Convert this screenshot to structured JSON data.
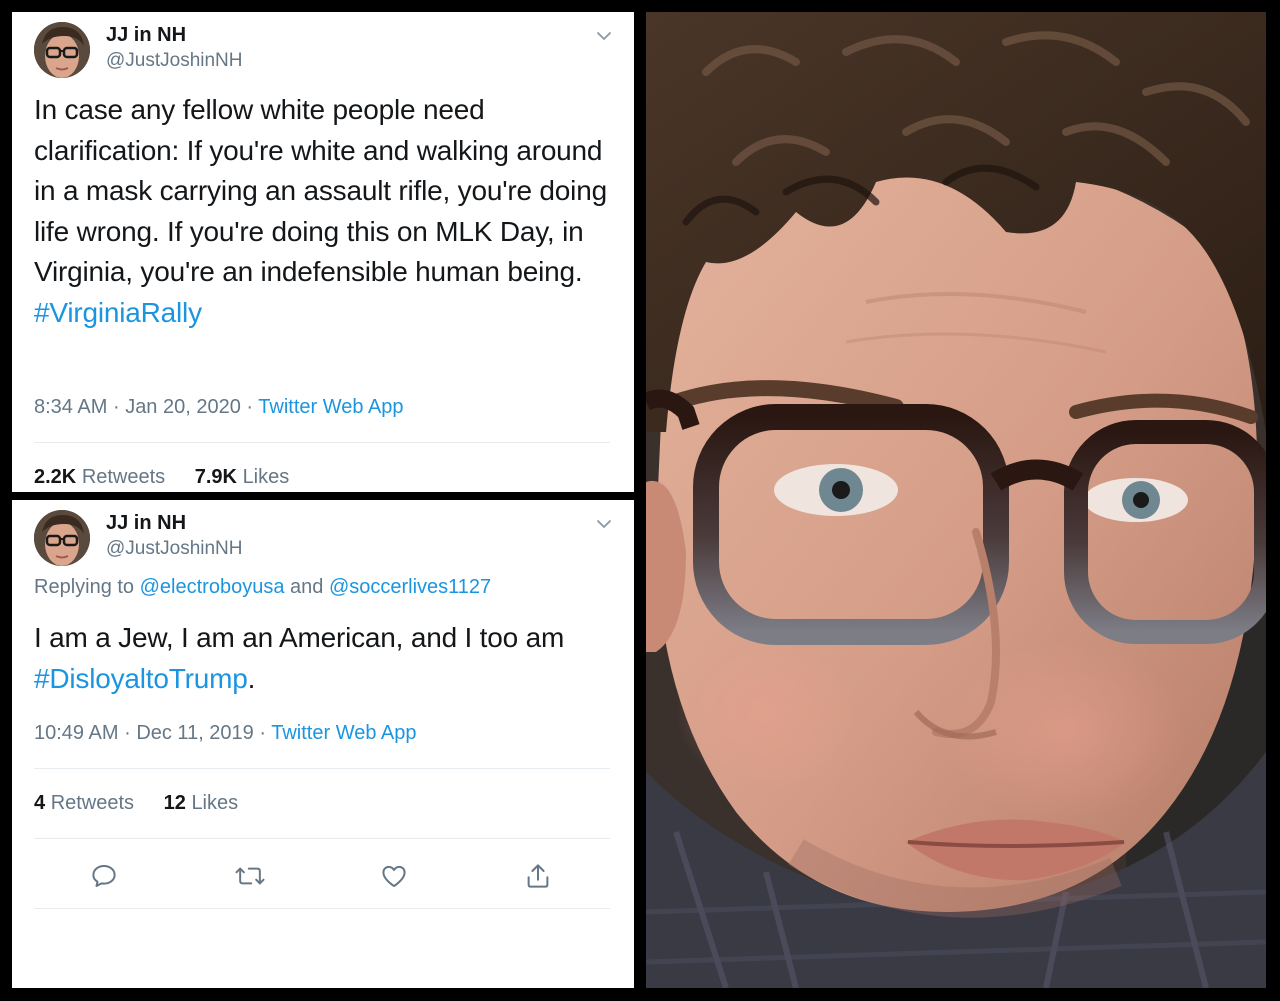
{
  "tweets": [
    {
      "author": {
        "name": "JJ in NH",
        "handle": "@JustJoshinNH"
      },
      "text": "In case any fellow white people need clarification: If you're white and walking around in a mask carrying an assault rifle, you're doing life wrong. If you're doing this on MLK Day, in Virginia, you're an indefensible human being.",
      "hashtag": "#VirginiaRally",
      "time": "8:34 AM",
      "date": "Jan 20, 2020",
      "source": "Twitter Web App",
      "retweets": "2.2K",
      "retweets_label": "Retweets",
      "likes": "7.9K",
      "likes_label": "Likes"
    },
    {
      "author": {
        "name": "JJ in NH",
        "handle": "@JustJoshinNH"
      },
      "reply_prefix": "Replying to",
      "reply_to_1": "@electroboyusa",
      "reply_and": "and",
      "reply_to_2": "@soccerlives1127",
      "text": "I am a Jew, I am an American, and I too am",
      "hashtag": "#DisloyaltoTrump",
      "text_suffix": ".",
      "time": "10:49 AM",
      "date": "Dec 11, 2019",
      "source": "Twitter Web App",
      "retweets": "4",
      "retweets_label": "Retweets",
      "likes": "12",
      "likes_label": "Likes"
    }
  ],
  "meta_separator": "·",
  "icons": {
    "caret": "chevron-down-icon",
    "reply": "comment-icon",
    "retweet": "retweet-icon",
    "like": "heart-icon",
    "share": "share-icon"
  },
  "colors": {
    "link": "#1b95e0",
    "text": "#14171a",
    "muted": "#657786",
    "divider": "#e6ecf0"
  }
}
